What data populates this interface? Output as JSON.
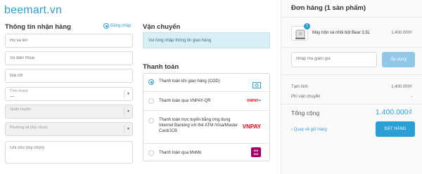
{
  "brand": {
    "logo": "beemart.vn"
  },
  "shipping_info": {
    "title": "Thông tin nhận hàng",
    "login_link": "Đăng nhập",
    "fullname_placeholder": "Họ và tên",
    "phone_placeholder": "Số điện thoại",
    "address_placeholder": "Địa chỉ",
    "province_label": "Tỉnh thành",
    "province_value": "---",
    "district_label": "Quận huyện",
    "ward_label": "Phường xã (tùy chọn)",
    "note_placeholder": "Ghi chú (tùy chọn)"
  },
  "shipping": {
    "title": "Vận chuyển",
    "notice": "Vui lòng nhập thông tin giao hàng"
  },
  "payment": {
    "title": "Thanh toán",
    "methods": [
      {
        "label": "Thanh toán khi giao hàng (COD)",
        "selected": true,
        "icon": "cash-icon"
      },
      {
        "label": "Thanh toán qua VNPAY-QR",
        "selected": false,
        "icon": "vnpay-qr-icon",
        "icon_text": "VNPAY"
      },
      {
        "label": "Thanh toán trực tuyến bằng ứng dụng Internet Banking với thẻ ATM /Visa/Master Card/JCB",
        "selected": false,
        "icon": "vnpay-logo-icon",
        "icon_text": "VNPAY"
      },
      {
        "label": "Thanh toán qua MoMo",
        "selected": false,
        "icon": "momo-icon",
        "icon_text": "mo\nmo"
      }
    ]
  },
  "order": {
    "title": "Đơn hàng (1 sản phẩm)",
    "item": {
      "qty": "1",
      "name": "Máy trộn và nhồi bột Bear 3,5L",
      "price": "1.400.000₫"
    },
    "discount_placeholder": "Nhập mã giảm giá",
    "apply_label": "Áp dụng",
    "subtotal_label": "Tạm tính",
    "subtotal_value": "1.400.000₫",
    "shipping_fee_label": "Phí vận chuyển",
    "shipping_fee_value": "-",
    "total_label": "Tổng cộng",
    "total_value": "1.400.000₫",
    "back_label": "‹ Quay về giỏ hàng",
    "checkout_label": "ĐẶT HÀNG"
  },
  "colors": {
    "accent": "#2a9fd6",
    "notice_bg": "#d9eef5",
    "apply_disabled": "#91c8e8"
  }
}
